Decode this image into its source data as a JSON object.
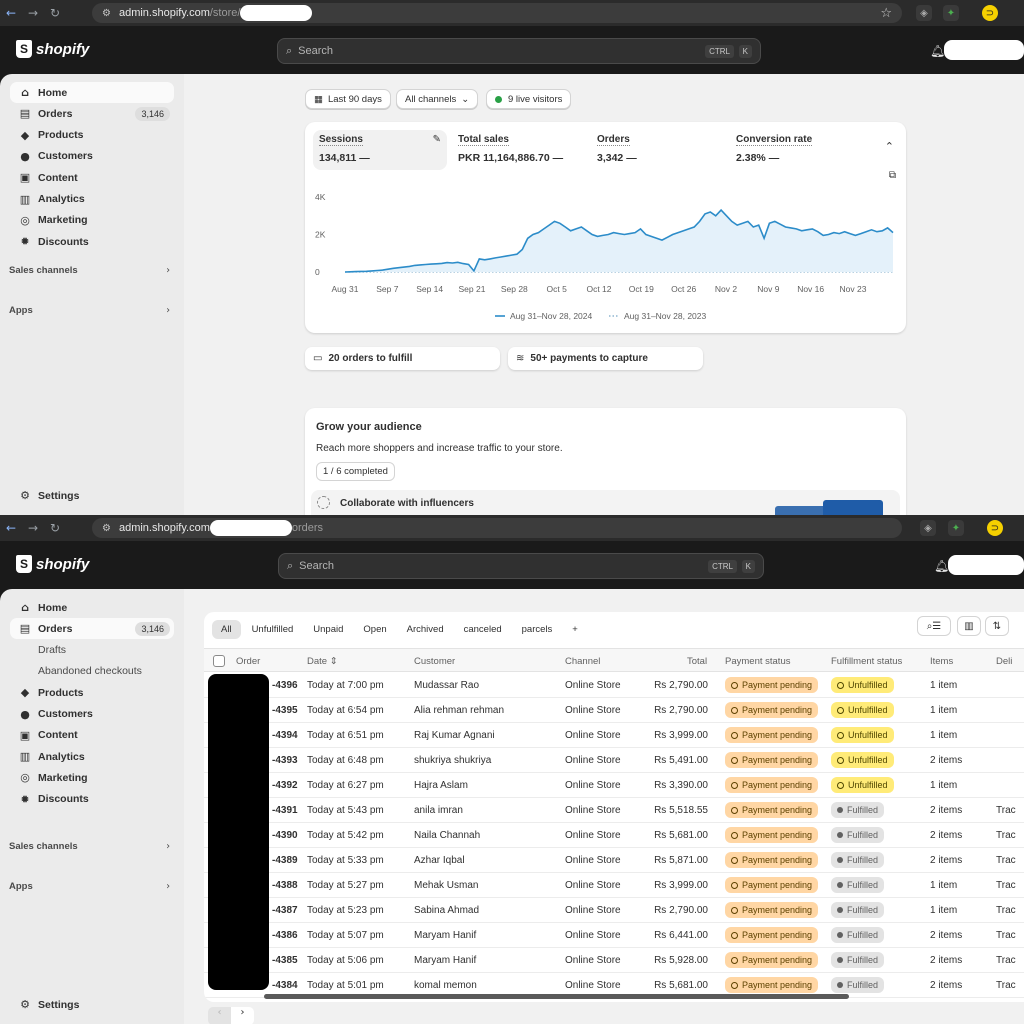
{
  "top": {
    "browser": {
      "url_host": "admin.shopify.com",
      "url_path": "/store/"
    },
    "brand": "shopify",
    "search_placeholder": "Search",
    "kbd_ctrl": "CTRL",
    "kbd_k": "K",
    "sidebar": {
      "items": [
        {
          "label": "Home",
          "icon": "home-icon"
        },
        {
          "label": "Orders",
          "icon": "orders-icon",
          "badge": "3,146"
        },
        {
          "label": "Products",
          "icon": "tag-icon"
        },
        {
          "label": "Customers",
          "icon": "person-icon"
        },
        {
          "label": "Content",
          "icon": "content-icon"
        },
        {
          "label": "Analytics",
          "icon": "chart-icon"
        },
        {
          "label": "Marketing",
          "icon": "target-icon"
        },
        {
          "label": "Discounts",
          "icon": "discount-icon"
        }
      ],
      "sales_channels": "Sales channels",
      "apps": "Apps",
      "settings": "Settings"
    },
    "filters": {
      "range": "Last 90 days",
      "channels": "All channels",
      "visitors": "9 live visitors"
    },
    "metrics": [
      {
        "label": "Sessions",
        "value": "134,811"
      },
      {
        "label": "Total sales",
        "value": "PKR 11,164,886.70"
      },
      {
        "label": "Orders",
        "value": "3,342"
      },
      {
        "label": "Conversion rate",
        "value": "2.38%"
      }
    ],
    "chart_data": {
      "type": "line",
      "title": "Sessions",
      "xlabel": "",
      "ylabel": "",
      "y_ticks": [
        "4K",
        "2K",
        "0"
      ],
      "ylim": [
        0,
        4000
      ],
      "x_ticks": [
        "Aug 31",
        "Sep 7",
        "Sep 14",
        "Sep 21",
        "Sep 28",
        "Oct 5",
        "Oct 12",
        "Oct 19",
        "Oct 26",
        "Nov 2",
        "Nov 9",
        "Nov 16",
        "Nov 23"
      ],
      "series": [
        {
          "name": "Aug 31–Nov 28, 2024",
          "style": "solid",
          "color": "#2c8cc9",
          "values": [
            0,
            10,
            20,
            30,
            40,
            60,
            80,
            100,
            150,
            200,
            230,
            260,
            300,
            350,
            380,
            400,
            420,
            440,
            460,
            500,
            480,
            520,
            450,
            400,
            60,
            700,
            650,
            700,
            750,
            800,
            850,
            900,
            950,
            1200,
            1800,
            2000,
            2100,
            2300,
            2500,
            2700,
            2600,
            2400,
            2200,
            2300,
            2400,
            2200,
            2000,
            1900,
            1950,
            2000,
            2100,
            2050,
            2000,
            2050,
            2100,
            2300,
            2000,
            1900,
            1800,
            1700,
            1850,
            2000,
            2100,
            2200,
            2300,
            2400,
            2700,
            3100,
            3200,
            3000,
            3300,
            3000,
            2700,
            2500,
            2600,
            2700,
            2400,
            2500,
            1800,
            2600,
            2700,
            2550,
            2400,
            2350,
            2300,
            2200,
            2250,
            2300,
            2150,
            1950,
            2000,
            2100,
            2050,
            2150,
            2050,
            1950,
            2050,
            2150,
            2250,
            2150,
            2200,
            2350,
            2100
          ]
        },
        {
          "name": "Aug 31–Nov 28, 2023",
          "style": "dotted",
          "color": "#8fb6d1",
          "values": [
            0,
            0,
            0,
            0,
            0,
            0,
            0,
            0,
            0,
            0,
            0,
            0,
            0
          ]
        }
      ]
    },
    "actions": [
      {
        "label": "20 orders to fulfill",
        "icon": "orders-icon"
      },
      {
        "label": "50+ payments to capture",
        "icon": "cash-icon"
      }
    ],
    "grow": {
      "title": "Grow your audience",
      "subtitle": "Reach more shoppers and increase traffic to your store.",
      "progress": "1 / 6 completed",
      "task": "Collaborate with influencers"
    }
  },
  "bottom": {
    "browser": {
      "url_host": "admin.shopify.com",
      "url_tail": "orders"
    },
    "sidebar": {
      "items": [
        {
          "label": "Home",
          "icon": "home-icon"
        },
        {
          "label": "Orders",
          "icon": "orders-icon",
          "badge": "3,146"
        },
        {
          "label": "Drafts",
          "sub": true
        },
        {
          "label": "Abandoned checkouts",
          "sub": true
        },
        {
          "label": "Products",
          "icon": "tag-icon"
        },
        {
          "label": "Customers",
          "icon": "person-icon"
        },
        {
          "label": "Content",
          "icon": "content-icon"
        },
        {
          "label": "Analytics",
          "icon": "chart-icon"
        },
        {
          "label": "Marketing",
          "icon": "target-icon"
        },
        {
          "label": "Discounts",
          "icon": "discount-icon"
        }
      ]
    },
    "tabs": [
      "All",
      "Unfulfilled",
      "Unpaid",
      "Open",
      "Archived",
      "canceled",
      "parcels",
      "+"
    ],
    "columns": [
      "Order",
      "Date",
      "Customer",
      "Channel",
      "Total",
      "Payment status",
      "Fulfillment status",
      "Items",
      "Deli"
    ],
    "orders": [
      {
        "order": "-4396",
        "date": "Today at 7:00 pm",
        "customer": "Mudassar Rao",
        "channel": "Online Store",
        "total": "Rs 2,790.00",
        "payment": "Payment pending",
        "fulfillment": "Unfulfilled",
        "items": "1 item",
        "delivery": ""
      },
      {
        "order": "-4395",
        "date": "Today at 6:54 pm",
        "customer": "Alia rehman rehman",
        "channel": "Online Store",
        "total": "Rs 2,790.00",
        "payment": "Payment pending",
        "fulfillment": "Unfulfilled",
        "items": "1 item",
        "delivery": ""
      },
      {
        "order": "-4394",
        "date": "Today at 6:51 pm",
        "customer": "Raj Kumar Agnani",
        "channel": "Online Store",
        "total": "Rs 3,999.00",
        "payment": "Payment pending",
        "fulfillment": "Unfulfilled",
        "items": "1 item",
        "delivery": ""
      },
      {
        "order": "-4393",
        "date": "Today at 6:48 pm",
        "customer": "shukriya shukriya",
        "channel": "Online Store",
        "total": "Rs 5,491.00",
        "payment": "Payment pending",
        "fulfillment": "Unfulfilled",
        "items": "2 items",
        "delivery": ""
      },
      {
        "order": "-4392",
        "date": "Today at 6:27 pm",
        "customer": "Hajra Aslam",
        "channel": "Online Store",
        "total": "Rs 3,390.00",
        "payment": "Payment pending",
        "fulfillment": "Unfulfilled",
        "items": "1 item",
        "delivery": ""
      },
      {
        "order": "-4391",
        "date": "Today at 5:43 pm",
        "customer": "anila imran",
        "channel": "Online Store",
        "total": "Rs 5,518.55",
        "payment": "Payment pending",
        "fulfillment": "Fulfilled",
        "items": "2 items",
        "delivery": "Trac"
      },
      {
        "order": "-4390",
        "date": "Today at 5:42 pm",
        "customer": "Naila Channah",
        "channel": "Online Store",
        "total": "Rs 5,681.00",
        "payment": "Payment pending",
        "fulfillment": "Fulfilled",
        "items": "2 items",
        "delivery": "Trac"
      },
      {
        "order": "-4389",
        "date": "Today at 5:33 pm",
        "customer": "Azhar Iqbal",
        "channel": "Online Store",
        "total": "Rs 5,871.00",
        "payment": "Payment pending",
        "fulfillment": "Fulfilled",
        "items": "2 items",
        "delivery": "Trac"
      },
      {
        "order": "-4388",
        "date": "Today at 5:27 pm",
        "customer": "Mehak Usman",
        "channel": "Online Store",
        "total": "Rs 3,999.00",
        "payment": "Payment pending",
        "fulfillment": "Fulfilled",
        "items": "1 item",
        "delivery": "Trac"
      },
      {
        "order": "-4387",
        "date": "Today at 5:23 pm",
        "customer": "Sabina Ahmad",
        "channel": "Online Store",
        "total": "Rs 2,790.00",
        "payment": "Payment pending",
        "fulfillment": "Fulfilled",
        "items": "1 item",
        "delivery": "Trac"
      },
      {
        "order": "-4386",
        "date": "Today at 5:07 pm",
        "customer": "Maryam Hanif",
        "channel": "Online Store",
        "total": "Rs 6,441.00",
        "payment": "Payment pending",
        "fulfillment": "Fulfilled",
        "items": "2 items",
        "delivery": "Trac"
      },
      {
        "order": "-4385",
        "date": "Today at 5:06 pm",
        "customer": "Maryam Hanif",
        "channel": "Online Store",
        "total": "Rs 5,928.00",
        "payment": "Payment pending",
        "fulfillment": "Fulfilled",
        "items": "2 items",
        "delivery": "Trac"
      },
      {
        "order": "-4384",
        "date": "Today at 5:01 pm",
        "customer": "komal memon",
        "channel": "Online Store",
        "total": "Rs 5,681.00",
        "payment": "Payment pending",
        "fulfillment": "Fulfilled",
        "items": "2 items",
        "delivery": "Trac"
      }
    ]
  },
  "colors": {
    "payment_pending": "#ffd6a4",
    "unfulfilled": "#ffeb78",
    "fulfilled": "#e3e3e3",
    "chart_line": "#2c8cc9",
    "live_dot": "#29a046"
  }
}
